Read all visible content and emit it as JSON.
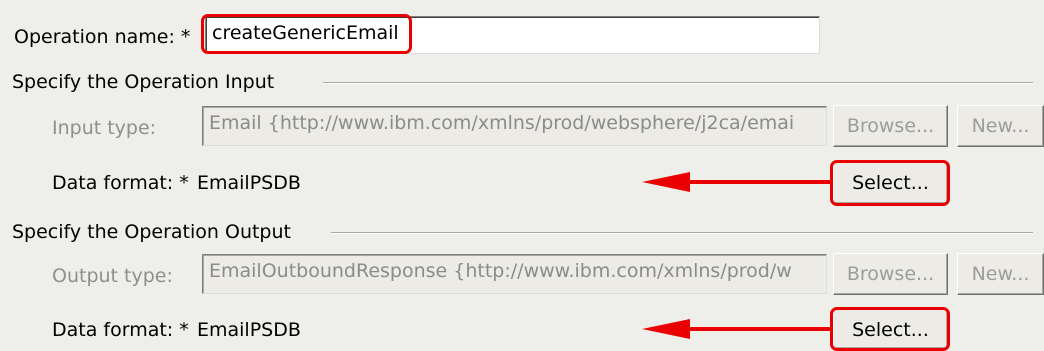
{
  "operation": {
    "name_label": "Operation name: *",
    "name_value": "createGenericEmail"
  },
  "input_group": {
    "title": "Specify the Operation Input",
    "type_label": "Input type:",
    "type_value": "Email  {http://www.ibm.com/xmlns/prod/websphere/j2ca/emai",
    "browse_label": "Browse...",
    "new_label": "New...",
    "data_format_label": "Data format: *",
    "data_format_value": "EmailPSDB",
    "select_label": "Select..."
  },
  "output_group": {
    "title": "Specify the Operation Output",
    "type_label": "Output type:",
    "type_value": "EmailOutboundResponse  {http://www.ibm.com/xmlns/prod/w",
    "browse_label": "Browse...",
    "new_label": "New...",
    "data_format_label": "Data format: *",
    "data_format_value": "EmailPSDB",
    "select_label": "Select..."
  },
  "colors": {
    "annotation_red": "#ea0000",
    "background": "#eeeeea"
  }
}
